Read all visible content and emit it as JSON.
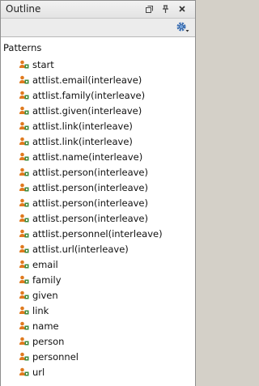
{
  "panel": {
    "title": "Outline",
    "root_label": "Patterns",
    "items": [
      "start",
      "attlist.email(interleave)",
      "attlist.family(interleave)",
      "attlist.given(interleave)",
      "attlist.link(interleave)",
      "attlist.link(interleave)",
      "attlist.name(interleave)",
      "attlist.person(interleave)",
      "attlist.person(interleave)",
      "attlist.person(interleave)",
      "attlist.person(interleave)",
      "attlist.personnel(interleave)",
      "attlist.url(interleave)",
      "email",
      "family",
      "given",
      "link",
      "name",
      "person",
      "personnel",
      "url"
    ]
  },
  "icons": {
    "minimize": "minimize-icon",
    "pin": "pin-icon",
    "close": "close-icon",
    "settings": "gear-icon",
    "pattern": "pattern-icon"
  },
  "colors": {
    "pattern_icon_orange": "#e07a1f",
    "pattern_icon_green": "#3c8a3c",
    "gear_blue": "#3a6fb5"
  }
}
